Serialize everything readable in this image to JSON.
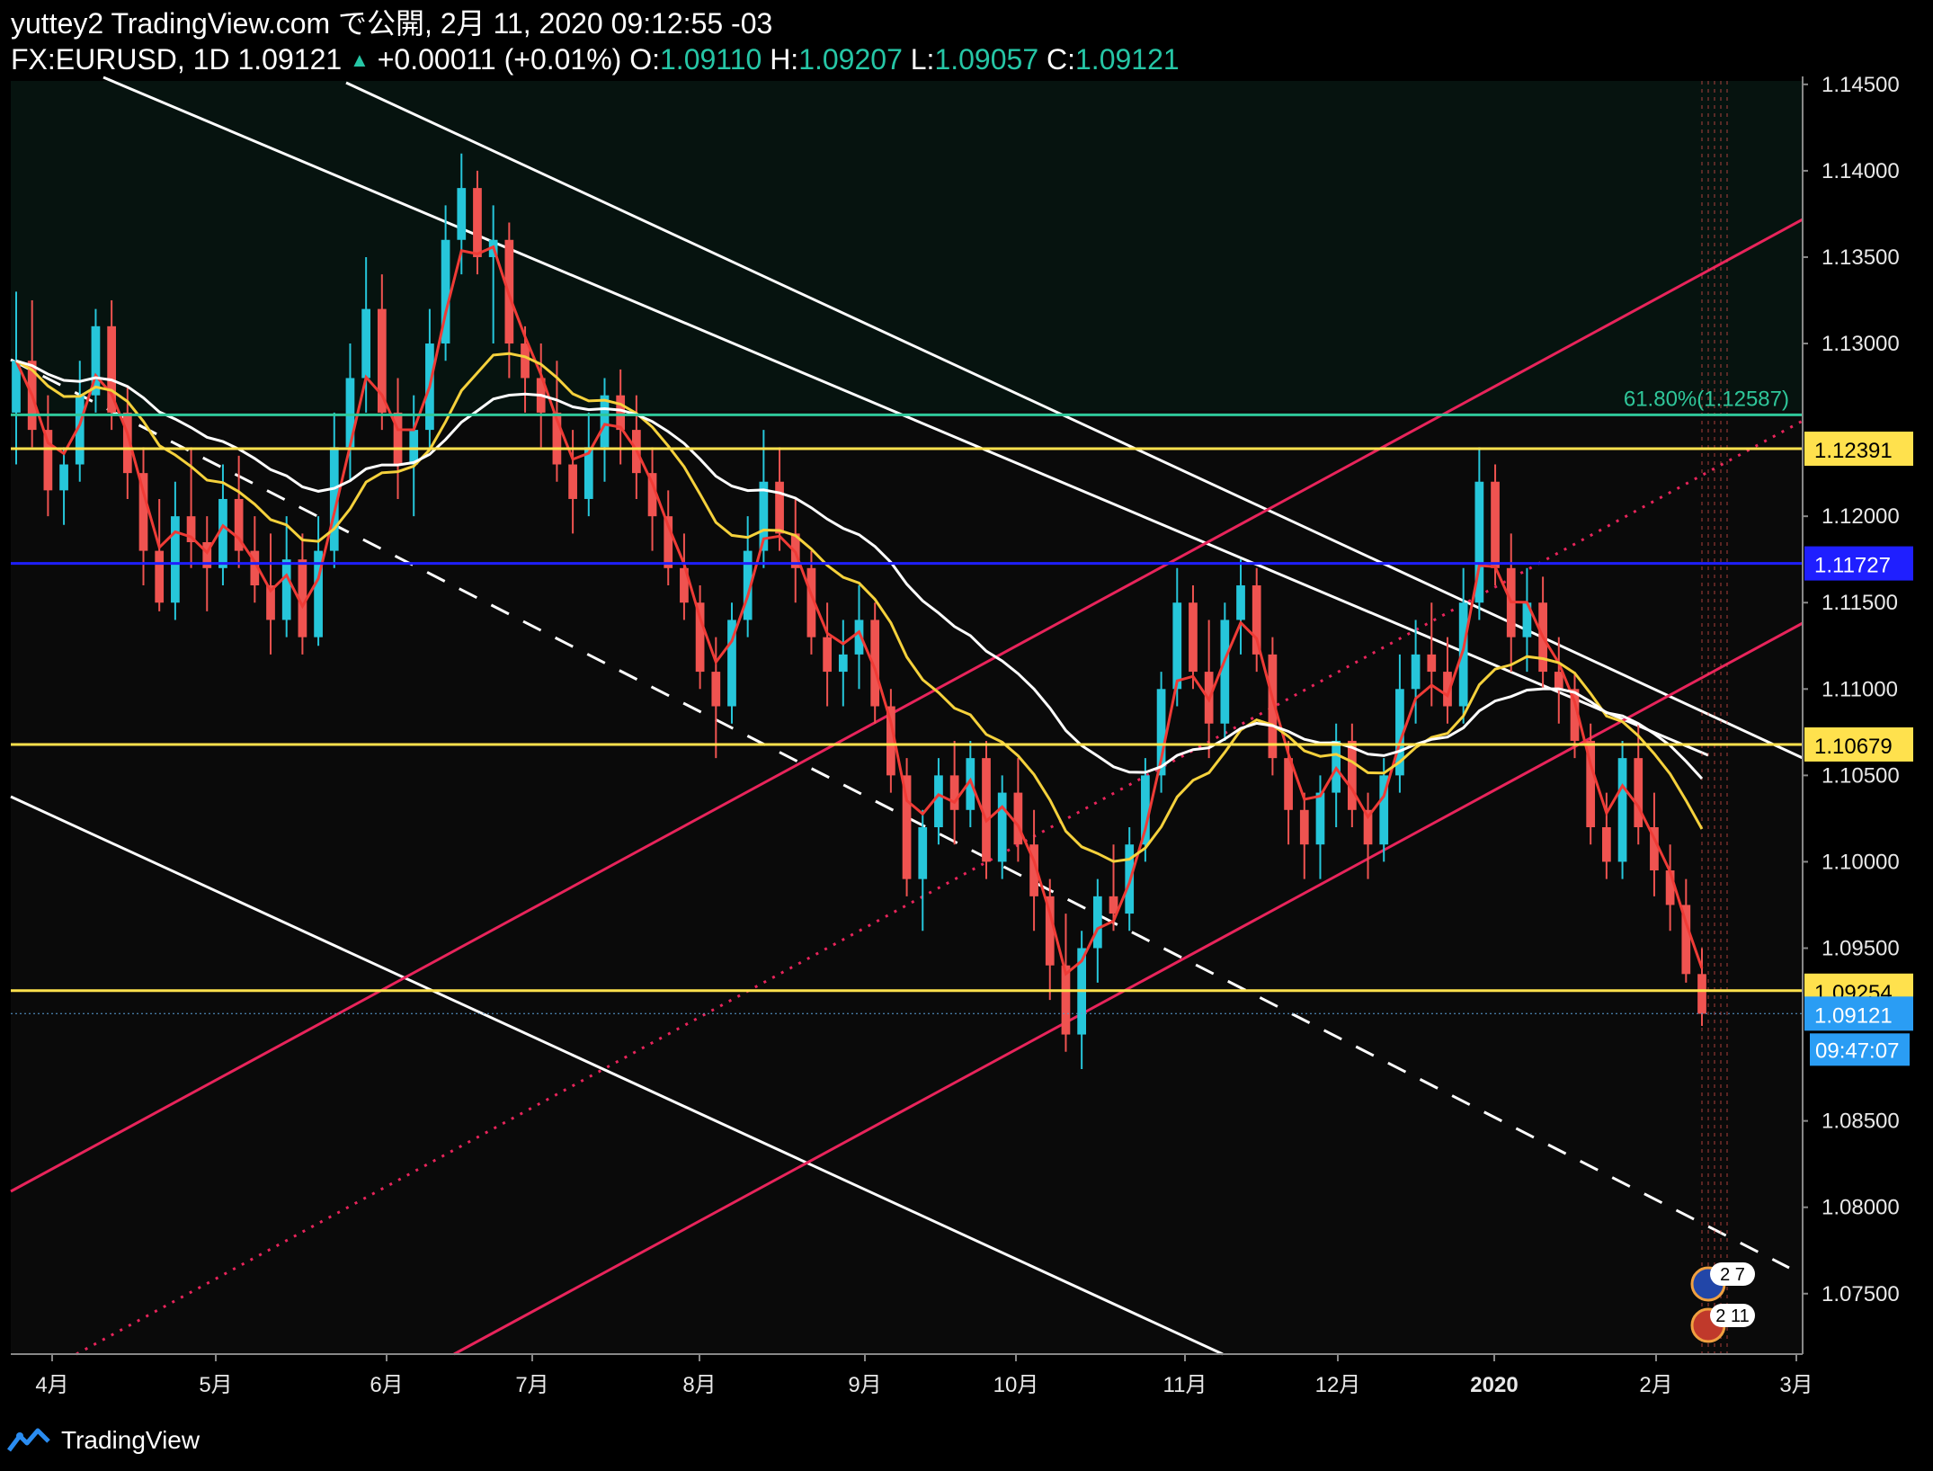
{
  "header": {
    "publisher_line": "yuttey2 TradingView.com で公開, 2月 11, 2020 09:12:55 -03",
    "symbol": "FX:EURUSD, 1D 1.09121",
    "change_arrow": "▲",
    "change": "+0.00011 (+0.01%)",
    "o_label": "O:",
    "o_value": "1.09110",
    "h_label": "H:",
    "h_value": "1.09207",
    "l_label": "L:",
    "l_value": "1.09057",
    "c_label": "C:",
    "c_value": "1.09121"
  },
  "footer": {
    "brand": "TradingView"
  },
  "colors": {
    "background": "#0a0a0a",
    "upper_zone": "#06130f",
    "candle_up": "#26c6da",
    "candle_down": "#ef5350",
    "ema_short": "#ef3b36",
    "ma_mid": "#f5d13c",
    "ma_long": "#ffffff",
    "channel": "#e8245b",
    "fib": "#2fc79a",
    "level_yellow": "#ffe14d",
    "level_blue": "#1f1fff"
  },
  "chart_data": {
    "type": "candlestick",
    "symbol": "FX:EURUSD",
    "timeframe": "1D",
    "ylim": [
      1.0715,
      1.1452
    ],
    "y_ticks": [
      "1.14500",
      "1.14000",
      "1.13500",
      "1.13000",
      "1.12000",
      "1.11500",
      "1.11000",
      "1.10500",
      "1.10000",
      "1.09500",
      "1.08500",
      "1.08000",
      "1.07500"
    ],
    "x_ticks": [
      "4月",
      "5月",
      "6月",
      "7月",
      "8月",
      "9月",
      "10月",
      "11月",
      "12月",
      "2020",
      "2月",
      "3月"
    ],
    "horizontal_levels": [
      {
        "value": 1.12391,
        "label": "1.12391",
        "color": "#ffe14d"
      },
      {
        "value": 1.11727,
        "label": "1.11727",
        "color": "#1f1fff"
      },
      {
        "value": 1.10679,
        "label": "1.10679",
        "color": "#ffe14d"
      },
      {
        "value": 1.09254,
        "label": "1.09254",
        "color": "#ffe14d"
      }
    ],
    "fib_level": {
      "value": 1.12587,
      "label": "61.80%(1.12587)"
    },
    "last_price": {
      "value": 1.09121,
      "label": "1.09121",
      "countdown": "09:47:07"
    },
    "candles": [
      [
        1.126,
        1.133,
        1.123,
        1.129
      ],
      [
        1.129,
        1.1325,
        1.124,
        1.125
      ],
      [
        1.125,
        1.127,
        1.12,
        1.1215
      ],
      [
        1.1215,
        1.124,
        1.1195,
        1.123
      ],
      [
        1.123,
        1.129,
        1.122,
        1.127
      ],
      [
        1.127,
        1.132,
        1.126,
        1.131
      ],
      [
        1.131,
        1.1325,
        1.125,
        1.126
      ],
      [
        1.126,
        1.1275,
        1.121,
        1.1225
      ],
      [
        1.1225,
        1.124,
        1.116,
        1.118
      ],
      [
        1.118,
        1.121,
        1.1145,
        1.115
      ],
      [
        1.115,
        1.122,
        1.114,
        1.12
      ],
      [
        1.12,
        1.124,
        1.117,
        1.1185
      ],
      [
        1.1185,
        1.12,
        1.1145,
        1.117
      ],
      [
        1.117,
        1.123,
        1.116,
        1.121
      ],
      [
        1.121,
        1.1235,
        1.117,
        1.118
      ],
      [
        1.118,
        1.12,
        1.115,
        1.116
      ],
      [
        1.116,
        1.119,
        1.112,
        1.114
      ],
      [
        1.114,
        1.12,
        1.113,
        1.1175
      ],
      [
        1.1175,
        1.119,
        1.112,
        1.113
      ],
      [
        1.113,
        1.12,
        1.1125,
        1.118
      ],
      [
        1.118,
        1.126,
        1.117,
        1.124
      ],
      [
        1.124,
        1.13,
        1.122,
        1.128
      ],
      [
        1.128,
        1.135,
        1.126,
        1.132
      ],
      [
        1.132,
        1.134,
        1.125,
        1.126
      ],
      [
        1.126,
        1.128,
        1.121,
        1.123
      ],
      [
        1.123,
        1.127,
        1.12,
        1.125
      ],
      [
        1.125,
        1.132,
        1.124,
        1.13
      ],
      [
        1.13,
        1.138,
        1.129,
        1.136
      ],
      [
        1.136,
        1.141,
        1.134,
        1.139
      ],
      [
        1.139,
        1.14,
        1.134,
        1.135
      ],
      [
        1.135,
        1.138,
        1.13,
        1.136
      ],
      [
        1.136,
        1.137,
        1.128,
        1.13
      ],
      [
        1.13,
        1.131,
        1.126,
        1.128
      ],
      [
        1.128,
        1.13,
        1.124,
        1.126
      ],
      [
        1.126,
        1.129,
        1.122,
        1.123
      ],
      [
        1.123,
        1.125,
        1.119,
        1.121
      ],
      [
        1.121,
        1.126,
        1.12,
        1.124
      ],
      [
        1.124,
        1.128,
        1.122,
        1.127
      ],
      [
        1.127,
        1.1285,
        1.123,
        1.125
      ],
      [
        1.125,
        1.127,
        1.121,
        1.1225
      ],
      [
        1.1225,
        1.124,
        1.118,
        1.12
      ],
      [
        1.12,
        1.1215,
        1.116,
        1.117
      ],
      [
        1.117,
        1.119,
        1.114,
        1.115
      ],
      [
        1.115,
        1.116,
        1.11,
        1.111
      ],
      [
        1.111,
        1.113,
        1.106,
        1.109
      ],
      [
        1.109,
        1.115,
        1.108,
        1.114
      ],
      [
        1.114,
        1.12,
        1.113,
        1.118
      ],
      [
        1.118,
        1.125,
        1.117,
        1.122
      ],
      [
        1.122,
        1.124,
        1.118,
        1.119
      ],
      [
        1.119,
        1.121,
        1.115,
        1.117
      ],
      [
        1.117,
        1.118,
        1.112,
        1.113
      ],
      [
        1.113,
        1.115,
        1.109,
        1.111
      ],
      [
        1.111,
        1.114,
        1.109,
        1.112
      ],
      [
        1.112,
        1.116,
        1.11,
        1.114
      ],
      [
        1.114,
        1.115,
        1.108,
        1.109
      ],
      [
        1.109,
        1.11,
        1.104,
        1.105
      ],
      [
        1.105,
        1.106,
        1.098,
        1.099
      ],
      [
        1.099,
        1.103,
        1.096,
        1.102
      ],
      [
        1.102,
        1.106,
        1.101,
        1.105
      ],
      [
        1.105,
        1.107,
        1.101,
        1.103
      ],
      [
        1.103,
        1.107,
        1.102,
        1.106
      ],
      [
        1.106,
        1.107,
        1.099,
        1.1
      ],
      [
        1.1,
        1.105,
        1.099,
        1.104
      ],
      [
        1.104,
        1.106,
        1.1,
        1.101
      ],
      [
        1.101,
        1.103,
        1.096,
        1.098
      ],
      [
        1.098,
        1.099,
        1.092,
        1.094
      ],
      [
        1.094,
        1.097,
        1.089,
        1.09
      ],
      [
        1.09,
        1.096,
        1.088,
        1.095
      ],
      [
        1.095,
        1.099,
        1.093,
        1.098
      ],
      [
        1.098,
        1.101,
        1.096,
        1.097
      ],
      [
        1.097,
        1.102,
        1.096,
        1.101
      ],
      [
        1.101,
        1.106,
        1.1,
        1.105
      ],
      [
        1.105,
        1.111,
        1.104,
        1.11
      ],
      [
        1.11,
        1.117,
        1.109,
        1.115
      ],
      [
        1.115,
        1.116,
        1.11,
        1.111
      ],
      [
        1.111,
        1.114,
        1.106,
        1.108
      ],
      [
        1.108,
        1.115,
        1.107,
        1.114
      ],
      [
        1.114,
        1.1175,
        1.112,
        1.116
      ],
      [
        1.116,
        1.117,
        1.111,
        1.112
      ],
      [
        1.112,
        1.113,
        1.105,
        1.106
      ],
      [
        1.106,
        1.107,
        1.101,
        1.103
      ],
      [
        1.103,
        1.104,
        1.099,
        1.101
      ],
      [
        1.101,
        1.105,
        1.099,
        1.104
      ],
      [
        1.104,
        1.108,
        1.102,
        1.107
      ],
      [
        1.107,
        1.108,
        1.102,
        1.103
      ],
      [
        1.103,
        1.104,
        1.099,
        1.101
      ],
      [
        1.101,
        1.106,
        1.1,
        1.105
      ],
      [
        1.105,
        1.112,
        1.104,
        1.11
      ],
      [
        1.11,
        1.114,
        1.108,
        1.112
      ],
      [
        1.112,
        1.115,
        1.109,
        1.111
      ],
      [
        1.111,
        1.113,
        1.108,
        1.109
      ],
      [
        1.109,
        1.117,
        1.108,
        1.115
      ],
      [
        1.115,
        1.124,
        1.114,
        1.122
      ],
      [
        1.122,
        1.123,
        1.116,
        1.117
      ],
      [
        1.117,
        1.119,
        1.111,
        1.113
      ],
      [
        1.113,
        1.117,
        1.111,
        1.115
      ],
      [
        1.115,
        1.1165,
        1.11,
        1.111
      ],
      [
        1.111,
        1.113,
        1.108,
        1.11
      ],
      [
        1.11,
        1.111,
        1.106,
        1.107
      ],
      [
        1.107,
        1.108,
        1.101,
        1.102
      ],
      [
        1.102,
        1.104,
        1.099,
        1.1
      ],
      [
        1.1,
        1.107,
        1.099,
        1.106
      ],
      [
        1.106,
        1.108,
        1.101,
        1.102
      ],
      [
        1.102,
        1.104,
        1.098,
        1.0995
      ],
      [
        1.0995,
        1.101,
        1.096,
        1.0975
      ],
      [
        1.0975,
        1.099,
        1.093,
        1.0935
      ],
      [
        1.0935,
        1.095,
        1.0905,
        1.0912
      ]
    ],
    "series": [
      {
        "name": "",
        "style": "ema_short"
      },
      {
        "name": "",
        "style": "ma_mid"
      },
      {
        "name": "",
        "style": "ma_long"
      }
    ],
    "event_badges": [
      {
        "label": "2 7"
      },
      {
        "label": "2 11"
      }
    ]
  }
}
